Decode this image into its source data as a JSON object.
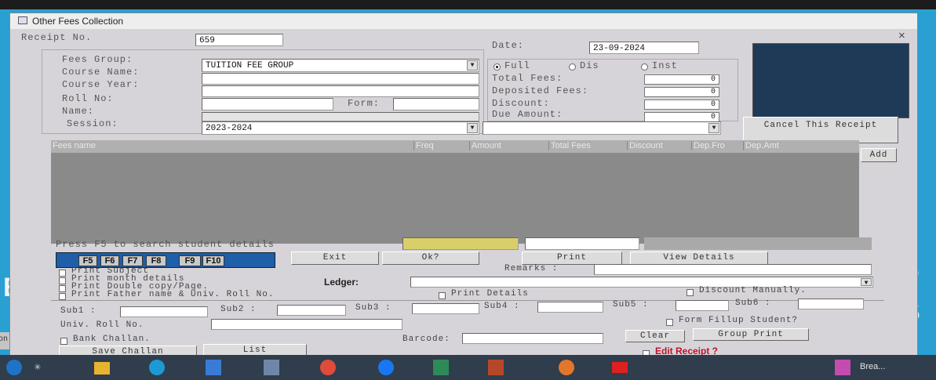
{
  "window": {
    "title": "Other Fees Collection",
    "close": "×"
  },
  "receipt": {
    "label": "Receipt No.",
    "value": "659"
  },
  "date": {
    "label": "Date:",
    "value": "23-09-2024"
  },
  "form": {
    "fees_group_label": "Fees Group:",
    "fees_group_value": "TUITION FEE GROUP",
    "course_name_label": "Course Name:",
    "course_year_label": "Course Year:",
    "roll_no_label": "Roll No:",
    "form_label": "Form:",
    "name_label": "Name:",
    "session_label": "Session:",
    "session_value": "2023-2024"
  },
  "payment": {
    "radio_full": "Full",
    "radio_dis": "Dis",
    "radio_inst": "Inst",
    "total_fees_label": "Total Fees:",
    "total_fees_value": "0",
    "deposited_label": "Deposited Fees:",
    "deposited_value": "0",
    "discount_label": "Discount:",
    "discount_value": "0",
    "due_label": "Due Amount:",
    "due_value": "0"
  },
  "cancel_button": "Cancel This Receipt",
  "grid": {
    "columns": [
      "Fees name",
      "Freq",
      "Amount",
      "Total Fees",
      "Discount",
      "Dep.Fro",
      "Dep.Amt"
    ],
    "add_button": "Add"
  },
  "search_hint": "Press F5 to search student details",
  "fkeys": [
    "F5",
    "F6",
    "F7",
    "F8",
    "F9",
    "F10"
  ],
  "actions": {
    "exit": "Exit",
    "ok": "Ok?",
    "print": "Print",
    "view": "View Details"
  },
  "options": {
    "print_subject": "Print Subject",
    "print_month": "Print month details",
    "print_double": "Print Double copy/Page.",
    "print_father": "Print Father name & Univ. Roll No.",
    "print_details": "Print Details",
    "discount_manually": "Discount Manually.",
    "remarks_label": "Remarks :",
    "ledger_label": "Ledger:"
  },
  "subjects": {
    "sub1": "Sub1 :",
    "sub2": "Sub2 :",
    "sub3": "Sub3 :",
    "sub4": "Sub4 :",
    "sub5": "Sub5 :",
    "sub6": "Sub6 :"
  },
  "bottom": {
    "univ_roll_label": "Univ. Roll No.",
    "form_fillup": "Form Fillup Student?",
    "bank_challan": "Bank Challan.",
    "barcode_label": "Barcode:",
    "clear_button": "Clear",
    "group_print_button": "Group Print",
    "save_challan_button": "Save Challan",
    "list_button": "List",
    "edit_receipt": "Edit Receipt ?"
  },
  "desktop": {
    "left_letter": "E",
    "right_letters": "T S",
    "left_edge_text": "sion"
  },
  "taskbar": {
    "right_label": "Brea..."
  },
  "colors": {
    "desktop": "#2a9fd2",
    "window": "#d7d4d9",
    "grid": "#8a8a8a",
    "fkey_bar": "#1f5ea8",
    "dark_panel": "#1e3a57",
    "edit_receipt": "#c0102a"
  }
}
